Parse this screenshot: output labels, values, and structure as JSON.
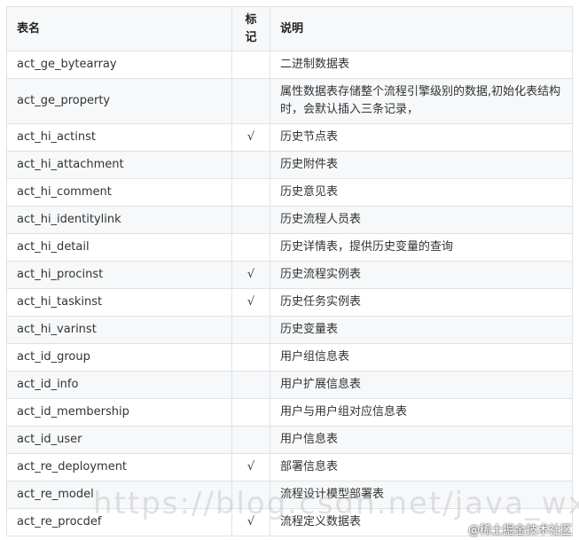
{
  "table": {
    "headers": {
      "name": "表名",
      "mark": "标记",
      "desc": "说明"
    },
    "rows": [
      {
        "name": "act_ge_bytearray",
        "mark": "",
        "desc": "二进制数据表"
      },
      {
        "name": "act_ge_property",
        "mark": "",
        "desc": "属性数据表存储整个流程引擎级别的数据,初始化表结构时，会默认插入三条记录，"
      },
      {
        "name": "act_hi_actinst",
        "mark": "√",
        "desc": "历史节点表"
      },
      {
        "name": "act_hi_attachment",
        "mark": "",
        "desc": "历史附件表"
      },
      {
        "name": "act_hi_comment",
        "mark": "",
        "desc": "历史意见表"
      },
      {
        "name": "act_hi_identitylink",
        "mark": "",
        "desc": "历史流程人员表"
      },
      {
        "name": "act_hi_detail",
        "mark": "",
        "desc": "历史详情表，提供历史变量的查询"
      },
      {
        "name": "act_hi_procinst",
        "mark": "√",
        "desc": "历史流程实例表"
      },
      {
        "name": "act_hi_taskinst",
        "mark": "√",
        "desc": "历史任务实例表"
      },
      {
        "name": "act_hi_varinst",
        "mark": "",
        "desc": "历史变量表"
      },
      {
        "name": "act_id_group",
        "mark": "",
        "desc": "用户组信息表"
      },
      {
        "name": "act_id_info",
        "mark": "",
        "desc": "用户扩展信息表"
      },
      {
        "name": "act_id_membership",
        "mark": "",
        "desc": "用户与用户组对应信息表"
      },
      {
        "name": "act_id_user",
        "mark": "",
        "desc": "用户信息表"
      },
      {
        "name": "act_re_deployment",
        "mark": "√",
        "desc": "部署信息表"
      },
      {
        "name": "act_re_model",
        "mark": "",
        "desc": "流程设计模型部署表"
      },
      {
        "name": "act_re_procdef",
        "mark": "√",
        "desc": "流程定义数据表"
      }
    ]
  },
  "watermark": "https://blog.csdn.net/java_wxid",
  "credit": "@稀土掘金技术社区"
}
